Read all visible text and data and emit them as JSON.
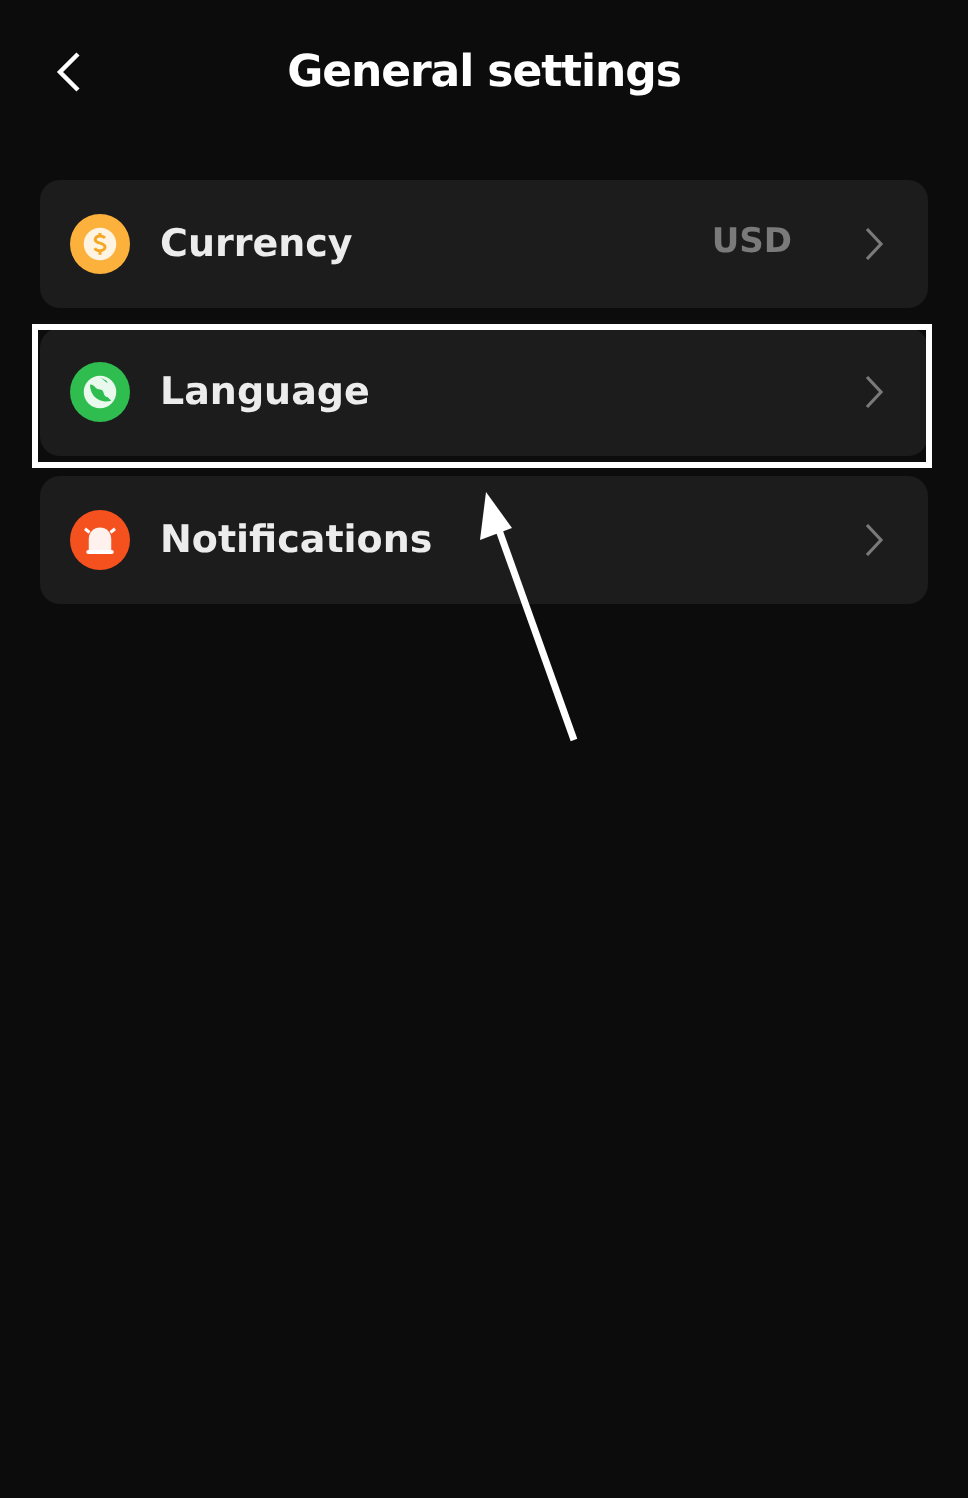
{
  "header": {
    "title": "General settings"
  },
  "items": [
    {
      "kind": "coin",
      "color": "#fbb13c",
      "label": "Currency",
      "value": "USD",
      "highlighted": false
    },
    {
      "kind": "globe",
      "color": "#2ebd4e",
      "label": "Language",
      "highlighted": true
    },
    {
      "kind": "bell",
      "color": "#f5511e",
      "label": "Notifications",
      "highlighted": false
    }
  ]
}
